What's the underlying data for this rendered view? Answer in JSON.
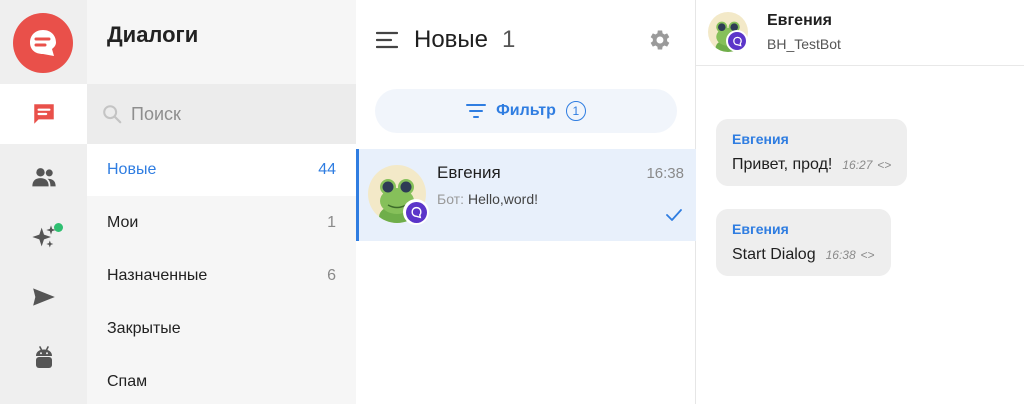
{
  "sidebar": {
    "title": "Диалоги",
    "search_placeholder": "Поиск",
    "folders": [
      {
        "label": "Новые",
        "count": "44"
      },
      {
        "label": "Мои",
        "count": "1"
      },
      {
        "label": "Назначенные",
        "count": "6"
      },
      {
        "label": "Закрытые",
        "count": ""
      },
      {
        "label": "Спам",
        "count": ""
      }
    ]
  },
  "list": {
    "title": "Новые",
    "count": "1",
    "filter_label": "Фильтр",
    "filter_count": "1",
    "dialogs": [
      {
        "name": "Евгения",
        "time": "16:38",
        "preview_prefix": "Бот:",
        "preview": "Hello,word!"
      }
    ]
  },
  "chat": {
    "contact_name": "Евгения",
    "bot_name": "BH_TestBot",
    "messages": [
      {
        "author": "Евгения",
        "text": "Привет, прод!",
        "time": "16:27",
        "code_icon": "<>"
      },
      {
        "author": "Евгения",
        "text": "Start Dialog",
        "time": "16:38",
        "code_icon": "<>"
      }
    ]
  },
  "colors": {
    "accent": "#2f7de1",
    "brand": "#e9504a",
    "bot_badge": "#5b35c9",
    "online": "#2fbf71"
  },
  "icons": {
    "rail": [
      "chat-icon",
      "contacts-icon",
      "sparkle-icon",
      "send-icon",
      "android-icon"
    ],
    "other": [
      "search-icon",
      "menu-icon",
      "gear-icon",
      "filter-icon",
      "check-icon"
    ]
  }
}
